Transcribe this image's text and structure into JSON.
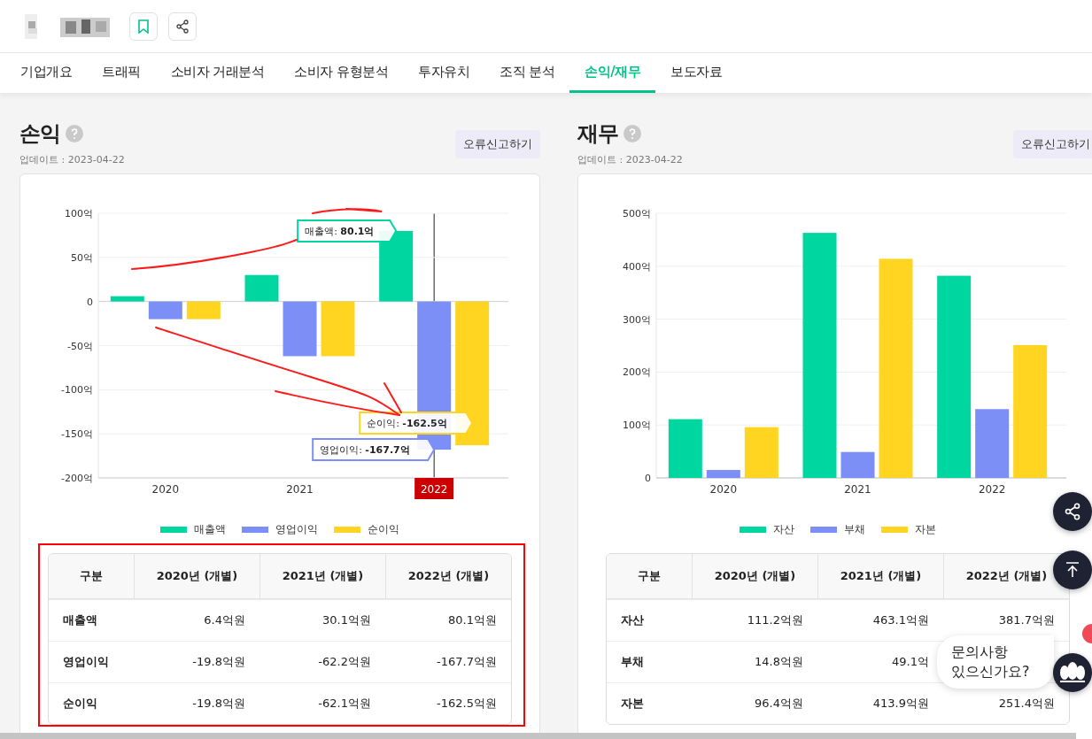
{
  "tabs": [
    {
      "label": "기업개요",
      "selected": false
    },
    {
      "label": "트래픽",
      "selected": false
    },
    {
      "label": "소비자 거래분석",
      "selected": false
    },
    {
      "label": "소비자 유형분석",
      "selected": false
    },
    {
      "label": "투자유치",
      "selected": false
    },
    {
      "label": "조직 분석",
      "selected": false
    },
    {
      "label": "손익/재무",
      "selected": true
    },
    {
      "label": "보도자료",
      "selected": false
    }
  ],
  "panels": [
    {
      "title": "손익",
      "updated": "업데이트 : 2023-04-22",
      "report_button": "오류신고하기",
      "outlined": true,
      "hover_category": "2022",
      "tooltips": [
        {
          "label": "매출액: ",
          "value": "80.1억"
        },
        {
          "label": "영업이익: ",
          "value": "-167.7억"
        },
        {
          "label": "순이익: ",
          "value": "-162.5억"
        }
      ],
      "chart_data": {
        "type": "bar",
        "grid": true,
        "categories": [
          "2020",
          "2021",
          "2022"
        ],
        "ylim": [
          -200,
          100
        ],
        "yticks": [
          {
            "value": 100,
            "label": "100억"
          },
          {
            "value": 50,
            "label": "50억"
          },
          {
            "value": 0,
            "label": "0"
          },
          {
            "value": -50,
            "label": "-50억"
          },
          {
            "value": -100,
            "label": "-100억"
          },
          {
            "value": -150,
            "label": "-150억"
          },
          {
            "value": -200,
            "label": "-200억"
          }
        ],
        "series": [
          {
            "name": "매출액",
            "color": "#00d6a0",
            "values": [
              6,
              30,
              80
            ]
          },
          {
            "name": "영업이익",
            "color": "#7b8ff7",
            "values": [
              -20,
              -62,
              -168
            ]
          },
          {
            "name": "순이익",
            "color": "#ffd521",
            "values": [
              -20,
              -62,
              -163
            ]
          }
        ]
      },
      "table": {
        "columns": [
          "구분",
          "2020년 (개별)",
          "2021년 (개별)",
          "2022년 (개별)"
        ],
        "rows": [
          {
            "cells": [
              "매출액",
              "6.4억원",
              "30.1억원",
              "80.1억원"
            ]
          },
          {
            "cells": [
              "영업이익",
              "-19.8억원",
              "-62.2억원",
              "-167.7억원"
            ]
          },
          {
            "cells": [
              "순이익",
              "-19.8억원",
              "-62.1억원",
              "-162.5억원"
            ]
          }
        ]
      }
    },
    {
      "title": "재무",
      "updated": "업데이트 : 2023-04-22",
      "report_button": "오류신고하기",
      "outlined": false,
      "chart_data": {
        "type": "bar",
        "grid": true,
        "categories": [
          "2020",
          "2021",
          "2022"
        ],
        "ylim": [
          0,
          500
        ],
        "yticks": [
          {
            "value": 500,
            "label": "500억"
          },
          {
            "value": 400,
            "label": "400억"
          },
          {
            "value": 300,
            "label": "300억"
          },
          {
            "value": 200,
            "label": "200억"
          },
          {
            "value": 100,
            "label": "100억"
          },
          {
            "value": 0,
            "label": "0"
          }
        ],
        "series": [
          {
            "name": "자산",
            "color": "#00d6a0",
            "values": [
              111,
              463,
              382
            ]
          },
          {
            "name": "부채",
            "color": "#7b8ff7",
            "values": [
              15,
              49,
              130
            ]
          },
          {
            "name": "자본",
            "color": "#ffd521",
            "values": [
              96,
              414,
              251
            ]
          }
        ]
      },
      "table": {
        "columns": [
          "구분",
          "2020년 (개별)",
          "2021년 (개별)",
          "2022년 (개별)"
        ],
        "rows": [
          {
            "cells": [
              "자산",
              "111.2억원",
              "463.1억원",
              "381.7억원"
            ]
          },
          {
            "cells": [
              "부채",
              "14.8억원",
              "49.1억"
            ]
          },
          {
            "cells": [
              "자본",
              "96.4억원",
              "413.9억원",
              "251.4억원"
            ]
          }
        ]
      }
    }
  ],
  "chat_prompt": "문의사항\n있으신가요?"
}
